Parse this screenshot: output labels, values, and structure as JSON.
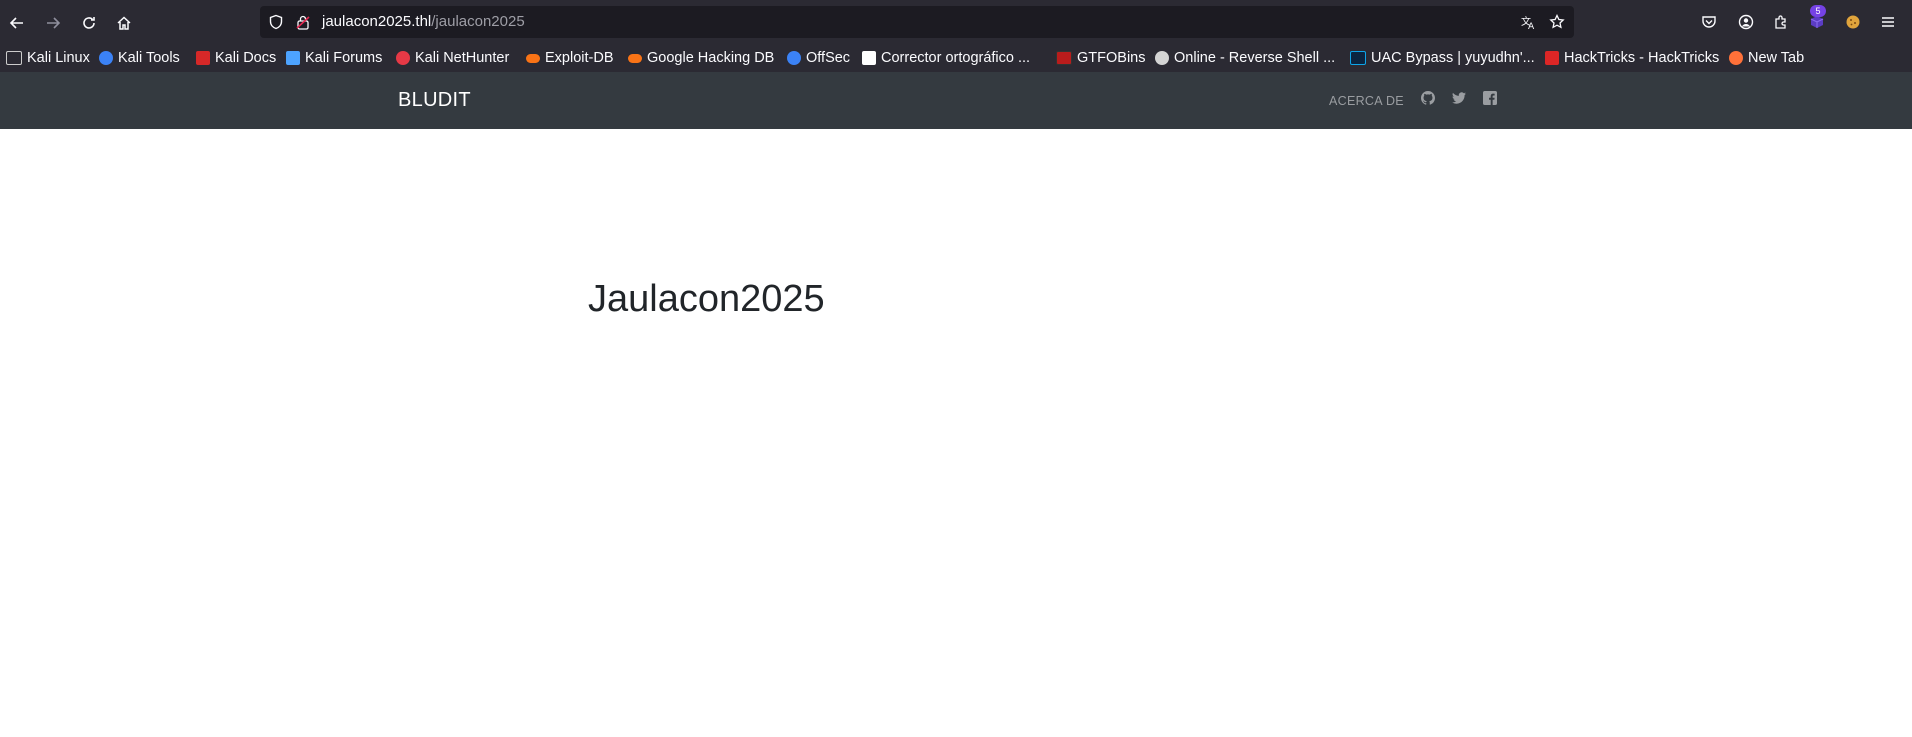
{
  "browser": {
    "url_host": "jaulacon2025.thl",
    "url_path": "/jaulacon2025",
    "extensions_badge": "5",
    "icons": [
      "back-arrow-icon",
      "forward-arrow-icon",
      "reload-icon",
      "home-icon",
      "shield-icon",
      "insecure-lock-icon",
      "translate-icon",
      "star-icon",
      "pocket-icon",
      "account-icon",
      "extensions-icon",
      "extension-badge-icon",
      "cookie-icon",
      "menu-icon"
    ]
  },
  "bookmarks": [
    {
      "label": "Kali Linux",
      "icon": "kali-dragon-icon",
      "color": "#e8e8e8"
    },
    {
      "label": "Kali Tools",
      "icon": "kali-tools-icon",
      "color": "#3b82f6"
    },
    {
      "label": "Kali Docs",
      "icon": "kali-docs-icon",
      "color": "#d62828"
    },
    {
      "label": "Kali Forums",
      "icon": "kali-forums-icon",
      "color": "#4da3ff"
    },
    {
      "label": "Kali NetHunter",
      "icon": "nethunter-icon",
      "color": "#e63946"
    },
    {
      "label": "Exploit-DB",
      "icon": "exploitdb-icon",
      "color": "#f97316"
    },
    {
      "label": "Google Hacking DB",
      "icon": "ghdb-icon",
      "color": "#f97316"
    },
    {
      "label": "OffSec",
      "icon": "offsec-icon",
      "color": "#3b82f6"
    },
    {
      "label": "Corrector ortográfico ...",
      "icon": "corrector-icon",
      "color": "#ffffff"
    },
    {
      "label": "GTFOBins",
      "icon": "gtfobins-icon",
      "color": "#b91c1c"
    },
    {
      "label": "Online - Reverse Shell ...",
      "icon": "skull-icon",
      "color": "#d4d4d4"
    },
    {
      "label": "UAC Bypass | yuyudhn'...",
      "icon": "uac-icon",
      "color": "#0ea5e9"
    },
    {
      "label": "HackTricks - HackTricks",
      "icon": "hacktricks-icon",
      "color": "#dc2626"
    },
    {
      "label": "New Tab",
      "icon": "firefox-icon",
      "color": "#ff7139"
    }
  ],
  "site": {
    "brand": "BLUDIT",
    "nav_about": "ACERCA DE",
    "nav_icons": [
      "github-icon",
      "twitter-icon",
      "facebook-icon"
    ],
    "page_title": "Jaulacon2025"
  },
  "colors": {
    "toolbar_bg": "#2b2a33",
    "urlbar_bg": "#1c1b22",
    "navbar_bg": "#343a40",
    "page_bg": "#ffffff",
    "title_color": "#212529"
  }
}
